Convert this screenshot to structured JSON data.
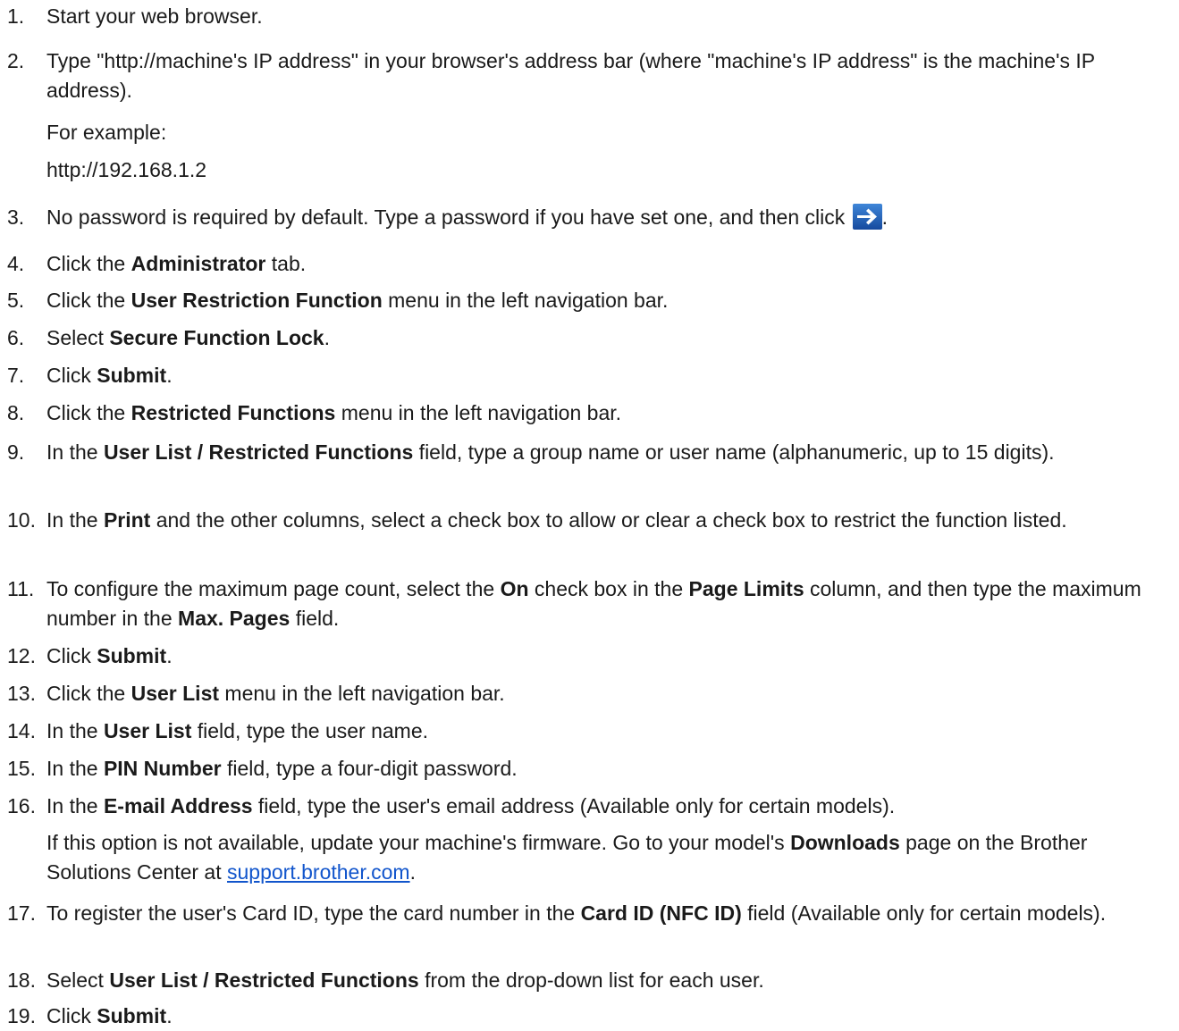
{
  "steps": [
    {
      "n": "1.",
      "parts": [
        {
          "t": "Start your web browser."
        }
      ]
    },
    {
      "n": "2.",
      "parts": [
        {
          "t": "Type \"http://machine's IP address\" in your browser's address bar (where \"machine's IP address\" is the machine's IP address)."
        }
      ]
    },
    {
      "n": "3.",
      "parts": [
        {
          "t": "No password is required by default. Type a password if you have set one, and then click "
        },
        {
          "icon": "go-arrow-icon"
        },
        {
          "t": "."
        }
      ]
    },
    {
      "n": "4.",
      "parts": [
        {
          "t": "Click the "
        },
        {
          "b": "Administrator"
        },
        {
          "t": " tab."
        }
      ]
    },
    {
      "n": "5.",
      "parts": [
        {
          "t": "Click the "
        },
        {
          "b": "User Restriction Function"
        },
        {
          "t": " menu in the left navigation bar."
        }
      ]
    },
    {
      "n": "6.",
      "parts": [
        {
          "t": "Select "
        },
        {
          "b": "Secure Function Lock"
        },
        {
          "t": "."
        }
      ]
    },
    {
      "n": "7.",
      "parts": [
        {
          "t": "Click "
        },
        {
          "b": "Submit"
        },
        {
          "t": "."
        }
      ]
    },
    {
      "n": "8.",
      "parts": [
        {
          "t": "Click the "
        },
        {
          "b": "Restricted Functions"
        },
        {
          "t": " menu in the left navigation bar."
        }
      ]
    },
    {
      "n": "9.",
      "parts": [
        {
          "t": "In the "
        },
        {
          "b": "User List / Restricted Functions"
        },
        {
          "t": " field, type a group name or user name (alphanumeric, up to 15 digits)."
        }
      ]
    },
    {
      "n": "10.",
      "parts": [
        {
          "t": "In the "
        },
        {
          "b": "Print"
        },
        {
          "t": " and the other columns, select a check box to allow or clear a check box to restrict the function listed."
        }
      ]
    },
    {
      "n": "11.",
      "parts": [
        {
          "t": "To configure the maximum page count, select the "
        },
        {
          "b": "On"
        },
        {
          "t": " check box in the "
        },
        {
          "b": "Page Limits"
        },
        {
          "t": " column, and then type the maximum number in the "
        },
        {
          "b": "Max. Pages"
        },
        {
          "t": " field."
        }
      ]
    },
    {
      "n": "12.",
      "parts": [
        {
          "t": "Click "
        },
        {
          "b": "Submit"
        },
        {
          "t": "."
        }
      ]
    },
    {
      "n": "13.",
      "parts": [
        {
          "t": "Click the "
        },
        {
          "b": "User List"
        },
        {
          "t": " menu in the left navigation bar."
        }
      ]
    },
    {
      "n": "14.",
      "parts": [
        {
          "t": "In the "
        },
        {
          "b": "User List"
        },
        {
          "t": " field, type the user name."
        }
      ]
    },
    {
      "n": "15.",
      "parts": [
        {
          "t": "In the "
        },
        {
          "b": "PIN Number"
        },
        {
          "t": " field, type a four-digit password."
        }
      ]
    },
    {
      "n": "16.",
      "parts": [
        {
          "t": "In the "
        },
        {
          "b": "E-mail Address"
        },
        {
          "t": " field, type the user's email address (Available only for certain models)."
        }
      ]
    },
    {
      "n": "17.",
      "parts": [
        {
          "t": "To register the user's Card ID, type the card number in the "
        },
        {
          "b": "Card ID (NFC ID)"
        },
        {
          "t": " field (Available only for certain models)."
        }
      ]
    },
    {
      "n": "18.",
      "parts": [
        {
          "t": "Select "
        },
        {
          "b": "User List / Restricted Functions"
        },
        {
          "t": " from the drop-down list for each user."
        }
      ]
    },
    {
      "n": "19.",
      "parts": [
        {
          "t": "Click "
        },
        {
          "b": "Submit"
        },
        {
          "t": "."
        }
      ]
    }
  ],
  "example": {
    "label": "For example:",
    "url": "http://192.168.1.2"
  },
  "firmware_note": {
    "parts": [
      {
        "t": "If this option is not available, update your machine's firmware. Go to your model's "
      },
      {
        "b": "Downloads"
      },
      {
        "t": " page on the Brother Solutions Center at "
      },
      {
        "link": "support.brother.com"
      },
      {
        "t": "."
      }
    ]
  },
  "colors": {
    "text": "#1a1a1a",
    "link": "#1155cc",
    "icon_bg": "#1f5bb8",
    "icon_arrow": "#ffffff"
  }
}
